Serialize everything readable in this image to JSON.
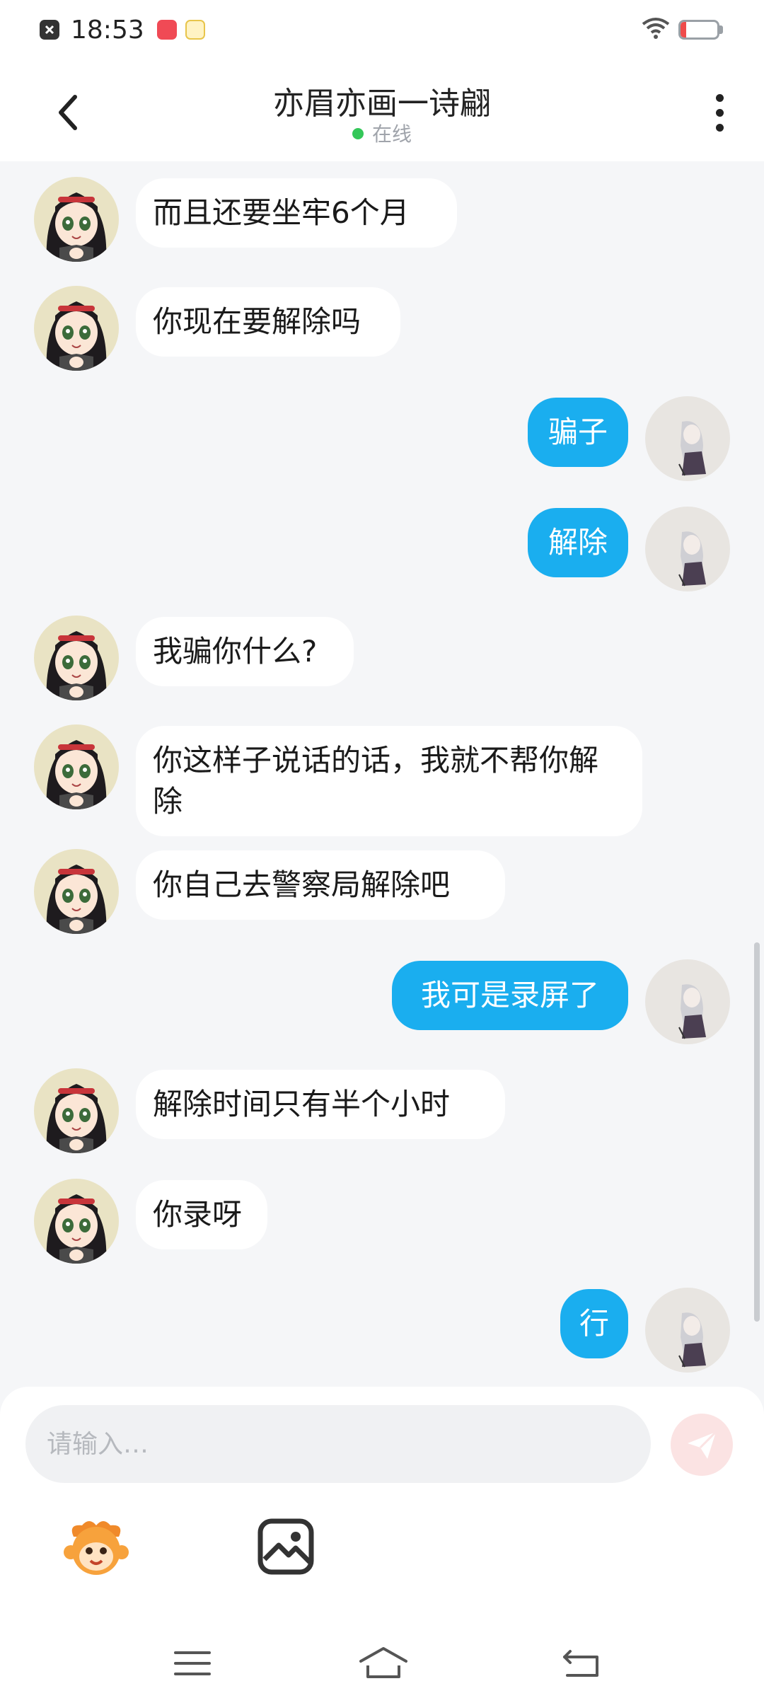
{
  "status_bar": {
    "time": "18:53",
    "battery": "15",
    "battery_level": 0.15,
    "icons": [
      "close-notification-icon",
      "app-notification-icon",
      "homework-app-icon",
      "wifi-icon",
      "battery-icon"
    ]
  },
  "header": {
    "title": "亦眉亦画一诗翩",
    "status": "在线",
    "status_color": "#34c759"
  },
  "messages": [
    {
      "side": "left",
      "text": "而且还要坐牢6个月"
    },
    {
      "side": "left",
      "text": "你现在要解除吗"
    },
    {
      "side": "right",
      "text": "骗子"
    },
    {
      "side": "right",
      "text": "解除"
    },
    {
      "side": "left",
      "text": "我骗你什么?"
    },
    {
      "side": "left",
      "text": "你这样子说话的话，我就不帮你解除"
    },
    {
      "side": "left",
      "text": "你自己去警察局解除吧"
    },
    {
      "side": "right",
      "text": "我可是录屏了"
    },
    {
      "side": "left",
      "text": "解除时间只有半个小时"
    },
    {
      "side": "left",
      "text": "你录呀"
    },
    {
      "side": "right",
      "text": "行"
    }
  ],
  "colors": {
    "sent_bubble": "#1aaeef",
    "received_bubble": "#ffffff",
    "background": "#f5f6f8"
  },
  "composer": {
    "placeholder": "请输入…",
    "send_icon": "send-icon",
    "tools": [
      "emoji-icon",
      "image-icon"
    ]
  },
  "nav": [
    "menu-icon",
    "home-icon",
    "back-icon"
  ]
}
